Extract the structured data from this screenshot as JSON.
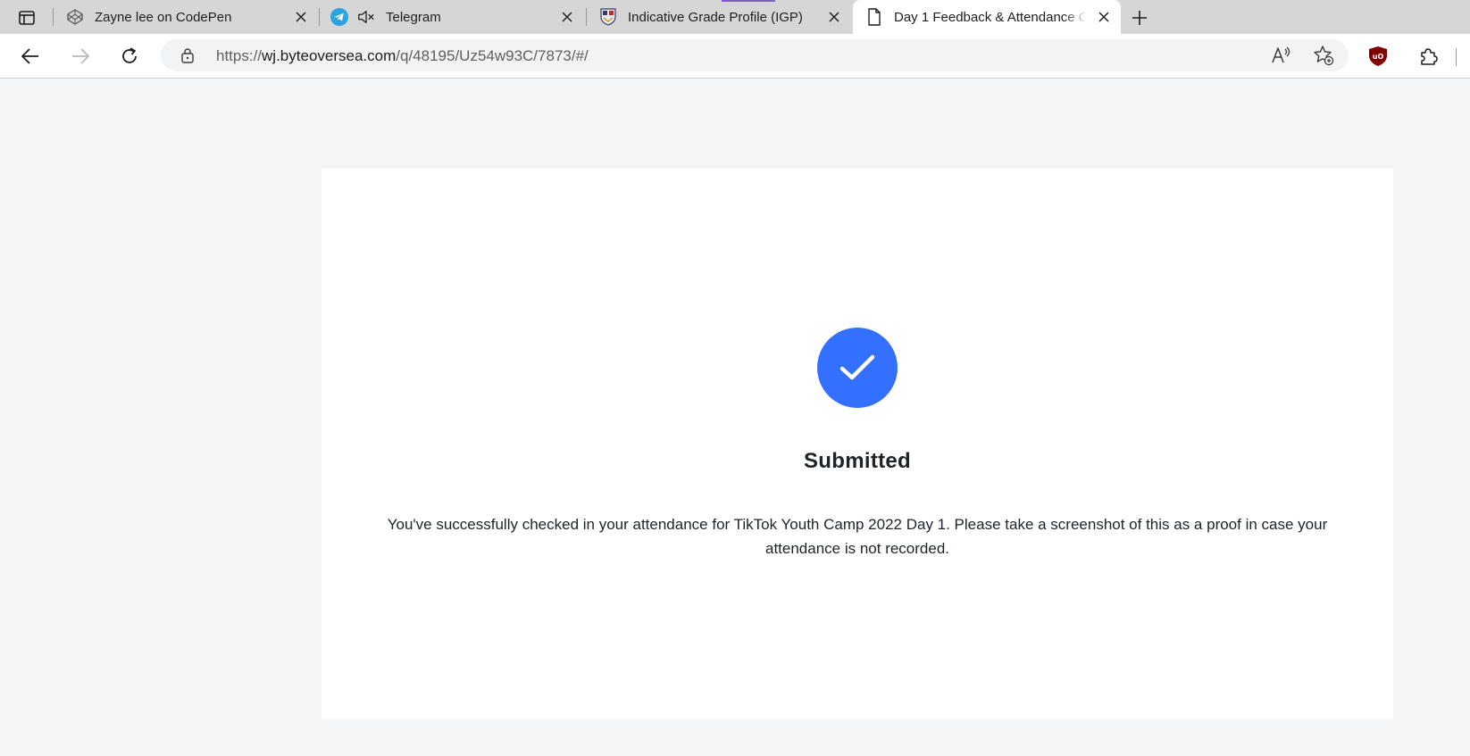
{
  "browser": {
    "tabs": [
      {
        "title": "Zayne lee on CodePen",
        "favicon": "codepen-icon"
      },
      {
        "title": "Telegram",
        "favicon": "telegram-icon",
        "muted_icon": "speaker-muted-icon"
      },
      {
        "title": "Indicative Grade Profile (IGP)",
        "favicon": "crest-icon"
      },
      {
        "title": "Day 1 Feedback & Attendance C",
        "favicon": "document-icon",
        "active": true
      }
    ],
    "address_bar": {
      "scheme": "https://",
      "host": "wj.byteoversea.com",
      "path": "/q/48195/Uz54w93C/7873/#/"
    },
    "icons": {
      "back": "back-arrow-icon",
      "forward": "forward-arrow-icon",
      "refresh": "refresh-icon",
      "lock": "lock-icon",
      "read_aloud": "read-aloud-icon",
      "favorites": "add-favorite-icon",
      "ublock": "ublock-icon",
      "extensions": "extensions-icon"
    }
  },
  "page": {
    "status_icon": "check-circle-icon",
    "status_color": "#3370ff",
    "heading": "Submitted",
    "message": "You've successfully checked in your attendance for TikTok Youth Camp 2022 Day 1. Please take a screenshot of this as a proof in case your attendance is not recorded."
  }
}
